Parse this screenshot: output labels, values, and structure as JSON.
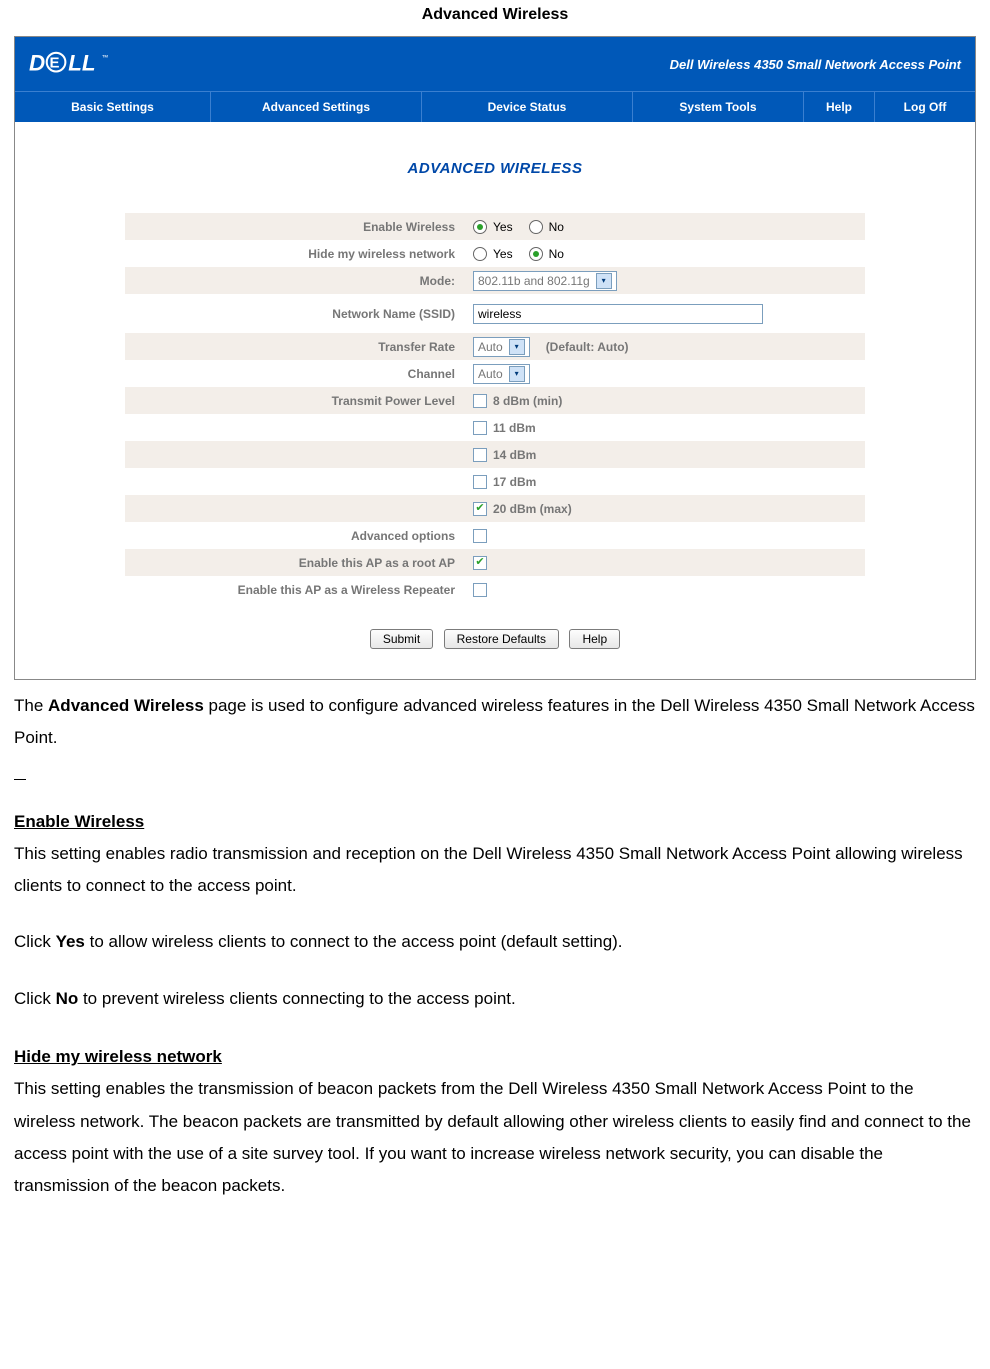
{
  "doc": {
    "title": "Advanced Wireless",
    "intro_prefix": "The ",
    "intro_bold": "Advanced Wireless",
    "intro_suffix": " page is used to configure advanced wireless features in the Dell Wireless 4350 Small Network Access Point.",
    "sec1": {
      "head": "Enable Wireless",
      "p1": "This setting enables radio transmission and reception on the Dell Wireless 4350 Small Network Access Point allowing wireless clients to connect to the access point.",
      "p2a": "Click ",
      "p2b": "Yes",
      "p2c": " to allow wireless clients to connect to the access point (default setting).",
      "p3a": "Click ",
      "p3b": "No",
      "p3c": " to prevent wireless clients connecting to the access point."
    },
    "sec2": {
      "head": "Hide my wireless network",
      "p1": "This setting enables the transmission of beacon packets from the Dell Wireless 4350 Small Network Access Point to the wireless network. The beacon packets are transmitted by default allowing other wireless clients to easily find and connect to the access point with the use of a site survey tool. If you want to increase wireless network security, you can disable the transmission of the beacon packets."
    }
  },
  "router": {
    "product": "Dell Wireless 4350 Small Network Access Point",
    "nav": {
      "basic": "Basic Settings",
      "advanced": "Advanced Settings",
      "status": "Device Status",
      "tools": "System Tools",
      "help": "Help",
      "logoff": "Log Off"
    },
    "section_title": "ADVANCED WIRELESS",
    "rows": {
      "enable_wireless": {
        "label": "Enable Wireless",
        "yes": "Yes",
        "no": "No"
      },
      "hide_network": {
        "label": "Hide my wireless network",
        "yes": "Yes",
        "no": "No"
      },
      "mode": {
        "label": "Mode:",
        "value": "802.11b and 802.11g"
      },
      "ssid": {
        "label": "Network Name (SSID)",
        "value": "wireless"
      },
      "rate": {
        "label": "Transfer Rate",
        "value": "Auto",
        "hint": "(Default: Auto)"
      },
      "channel": {
        "label": "Channel",
        "value": "Auto"
      },
      "tx_power": {
        "label": "Transmit Power Level",
        "opts": [
          "8 dBm (min)",
          "11 dBm",
          "14 dBm",
          "17 dBm",
          "20 dBm (max)"
        ]
      },
      "adv_opts": {
        "label": "Advanced options"
      },
      "root_ap": {
        "label": "Enable this AP as a root AP"
      },
      "repeater": {
        "label": "Enable this AP as a Wireless Repeater"
      }
    },
    "buttons": {
      "submit": "Submit",
      "restore": "Restore Defaults",
      "help": "Help"
    }
  }
}
